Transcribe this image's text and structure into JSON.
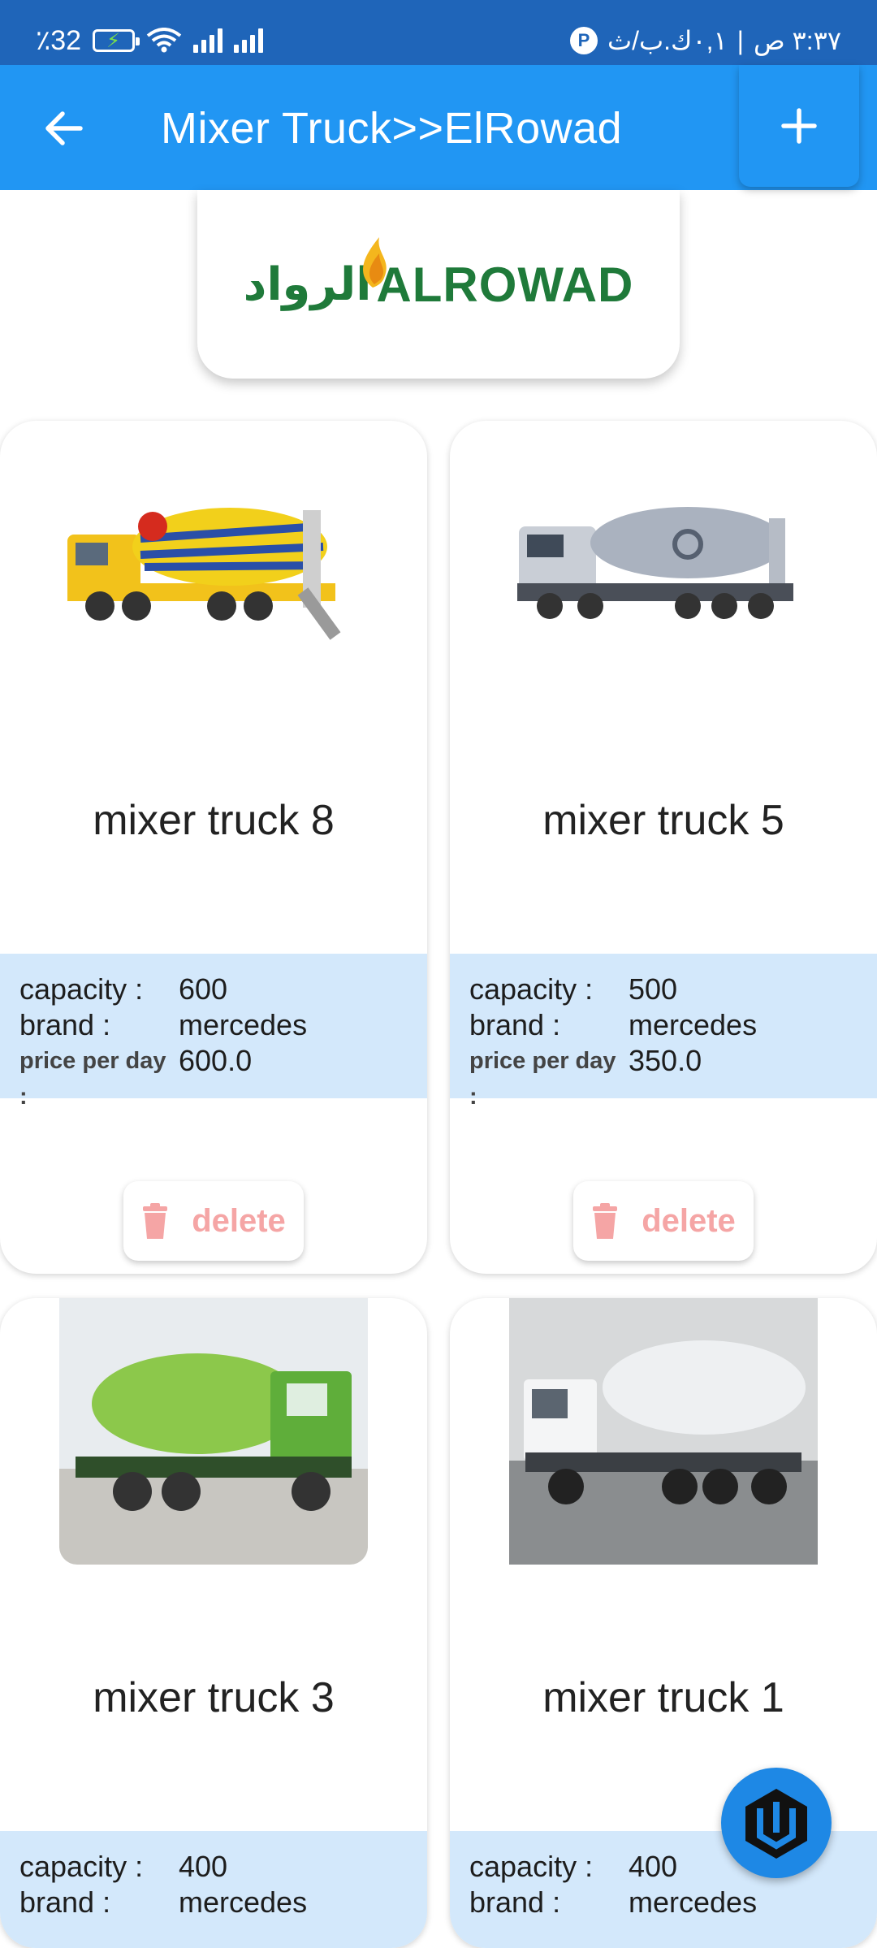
{
  "status_bar": {
    "battery_percent": "٪32",
    "time": "٣:٣٧ ص",
    "data_speed": "٠,١ك.ب/ث"
  },
  "app_bar": {
    "title": "Mixer Truck>>ElRowad",
    "back_icon": "arrow-left-icon",
    "add_icon": "plus-icon"
  },
  "brand": {
    "name_ar": "الرواد",
    "name_en": "ALROWAD"
  },
  "labels": {
    "capacity": "capacity :",
    "brand": "brand :",
    "price_per_day": "price per day :",
    "delete": "delete"
  },
  "trucks": [
    {
      "name": "mixer truck 8",
      "capacity": "600",
      "brand": "mercedes",
      "price_per_day": "600.0",
      "color": "#f2c21b"
    },
    {
      "name": "mixer truck 5",
      "capacity": "500",
      "brand": "mercedes",
      "price_per_day": "350.0",
      "color": "#9ea6b4"
    },
    {
      "name": "mixer truck 3",
      "capacity": "400",
      "brand": "mercedes",
      "price_per_day": "",
      "color": "#7cc242"
    },
    {
      "name": "mixer truck 1",
      "capacity": "400",
      "brand": "mercedes",
      "price_per_day": "",
      "color": "#e9ecef"
    }
  ]
}
